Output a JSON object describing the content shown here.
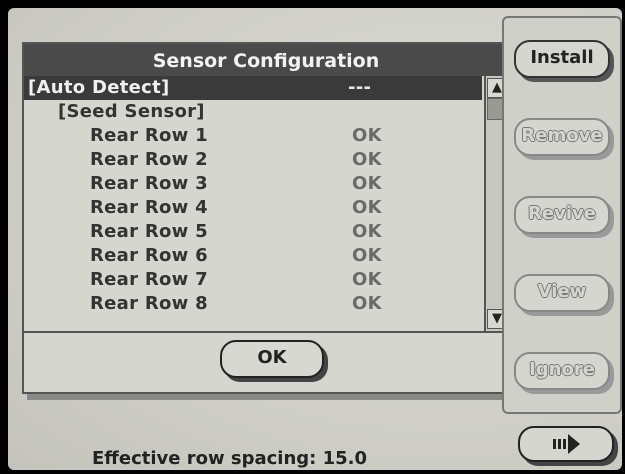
{
  "dialog": {
    "title": "Sensor Configuration",
    "rows": [
      {
        "label": "[Auto Detect]",
        "value": "---",
        "selected": true
      },
      {
        "label": "[Seed Sensor]",
        "value": ""
      },
      {
        "label": "Rear Row 1",
        "value": "OK"
      },
      {
        "label": "Rear Row 2",
        "value": "OK"
      },
      {
        "label": "Rear Row 3",
        "value": "OK"
      },
      {
        "label": "Rear Row 4",
        "value": "OK"
      },
      {
        "label": "Rear Row 5",
        "value": "OK"
      },
      {
        "label": "Rear Row 6",
        "value": "OK"
      },
      {
        "label": "Rear Row 7",
        "value": "OK"
      },
      {
        "label": "Rear Row 8",
        "value": "OK"
      }
    ],
    "ok_label": "OK",
    "scroll_up_icon": "arrow-up-icon",
    "scroll_down_icon": "arrow-down-icon"
  },
  "side": {
    "install": "Install",
    "remove": "Remove",
    "revive": "Revive",
    "view": "View",
    "ignore": "Ignore",
    "next_icon": "next-page-arrow-icon"
  },
  "status": {
    "text": "Effective row spacing: 15.0"
  }
}
